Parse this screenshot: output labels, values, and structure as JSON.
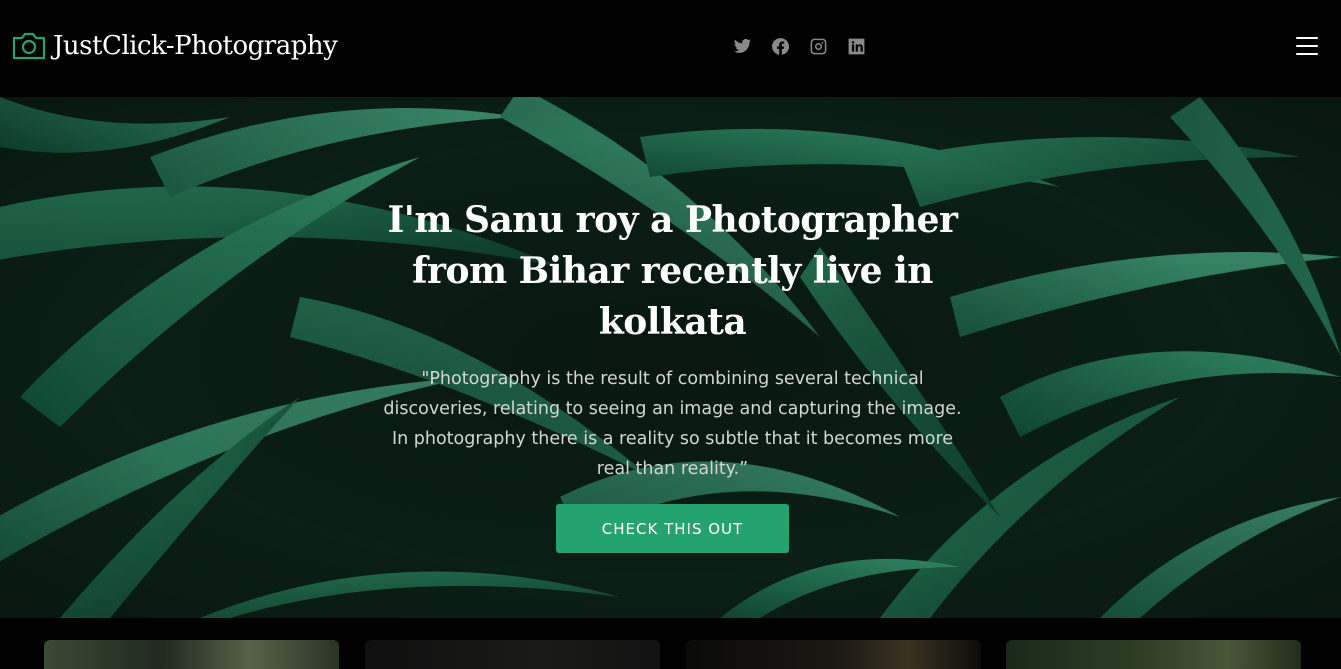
{
  "header": {
    "brand": "JustClick-Photography",
    "social": [
      {
        "name": "twitter-icon"
      },
      {
        "name": "facebook-icon"
      },
      {
        "name": "instagram-icon"
      },
      {
        "name": "linkedin-icon"
      }
    ]
  },
  "hero": {
    "title": "I'm Sanu roy a Photographer from Bihar recently live in kolkata",
    "quote": "\"Photography is the result of combining several technical discoveries, relating to seeing an image and capturing the image. In photography there is a reality so subtle that it becomes more real than reality.”",
    "cta_label": "CHECK THIS OUT"
  },
  "colors": {
    "accent": "#25a36f",
    "header_bg": "#000000",
    "social_icon": "#8a8a8a"
  }
}
